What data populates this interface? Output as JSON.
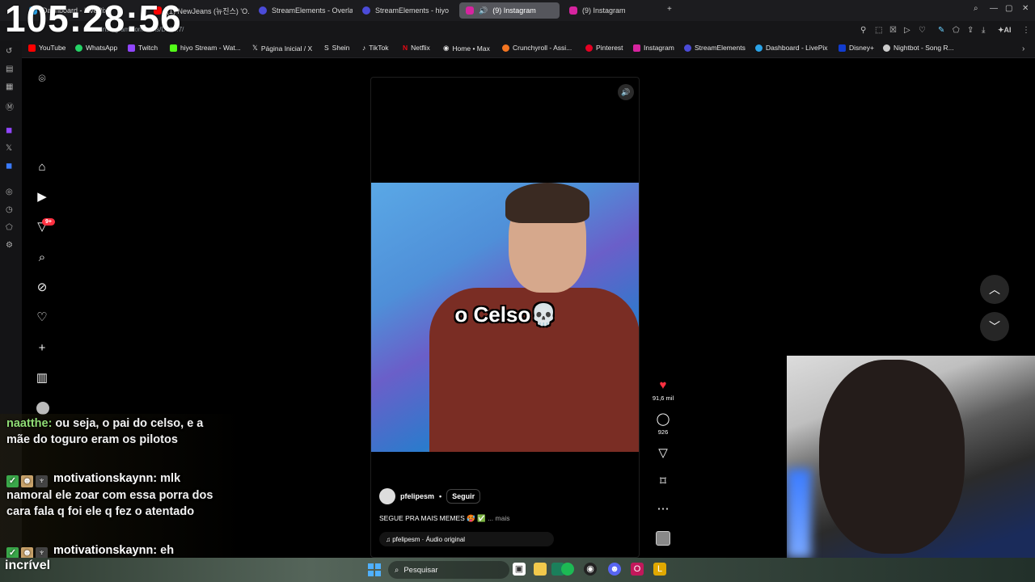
{
  "overlay": {
    "clock": "105:28:56",
    "taskbar_text": "incrível"
  },
  "browser": {
    "url": "www.instagram.com/reels/DL9...7/",
    "tabs": [
      {
        "label": "Dashboard - LivePix",
        "icon": "livepix-icon",
        "color": "#2aa3e8"
      },
      {
        "label": "(1) NewJeans (뉴진스) 'O...",
        "icon": "youtube-icon",
        "color": "#ff0000"
      },
      {
        "label": "StreamElements - Overlay",
        "icon": "streamelements-icon",
        "color": "#4b4bd8"
      },
      {
        "label": "StreamElements - hiyo",
        "icon": "streamelements-icon",
        "color": "#4b4bd8"
      },
      {
        "label": "(9) Instagram",
        "icon": "instagram-icon",
        "color": "#d6249f",
        "active": true
      },
      {
        "label": "(9) Instagram",
        "icon": "instagram-icon",
        "color": "#d6249f"
      }
    ],
    "bookmarks": [
      {
        "label": "YouTube",
        "color": "#ff0000"
      },
      {
        "label": "WhatsApp",
        "color": "#25d366"
      },
      {
        "label": "Twitch",
        "color": "#9146ff"
      },
      {
        "label": "hiyo Stream - Wat...",
        "color": "#53fc18"
      },
      {
        "label": "Página Inicial / X",
        "color": "#888888"
      },
      {
        "label": "Shein",
        "color": "#ffffff"
      },
      {
        "label": "TikTok",
        "color": "#ffffff"
      },
      {
        "label": "Netflix",
        "color": "#e50914"
      },
      {
        "label": "Home • Max",
        "color": "#ffffff"
      },
      {
        "label": "Crunchyroll - Assi...",
        "color": "#f47521"
      },
      {
        "label": "Pinterest",
        "color": "#e60023"
      },
      {
        "label": "Instagram",
        "color": "#d6249f"
      },
      {
        "label": "StreamElements",
        "color": "#4b4bd8"
      },
      {
        "label": "Dashboard - LivePix",
        "color": "#2aa3e8"
      },
      {
        "label": "Disney+",
        "color": "#113ccf"
      },
      {
        "label": "Nightbot - Song R...",
        "color": "#cccccc"
      }
    ]
  },
  "instagram": {
    "notifications_badge": "9+",
    "video_caption": "o Celso💀",
    "author": "pfelipesm",
    "follow_label": "Seguir",
    "dot": "•",
    "post_caption": "SEGUE PRA MAIS MEMES 🥵 ✅",
    "more_label": "... mais",
    "audio_label": "♫ pfelipesm · Áudio original",
    "likes": "91,6 mil",
    "comments": "926"
  },
  "chat": [
    {
      "user": "naatthe:",
      "text": " ou seja, o pai do celso, e a mãe do toguro eram os pilotos",
      "badges": false
    },
    {
      "user": "motivationskaynn:",
      "text": " mlk namoral ele zoar com essa porra dos cara fala q foi ele q fez o atentado",
      "badges": true
    },
    {
      "user": "motivationskaynn:",
      "text": " eh",
      "badges": true
    }
  ],
  "taskbar": {
    "search_placeholder": "Pesquisar"
  },
  "colors": {
    "like_red": "#ff3040",
    "chat_green": "#8fdc74",
    "active_tab": "#55565c"
  }
}
